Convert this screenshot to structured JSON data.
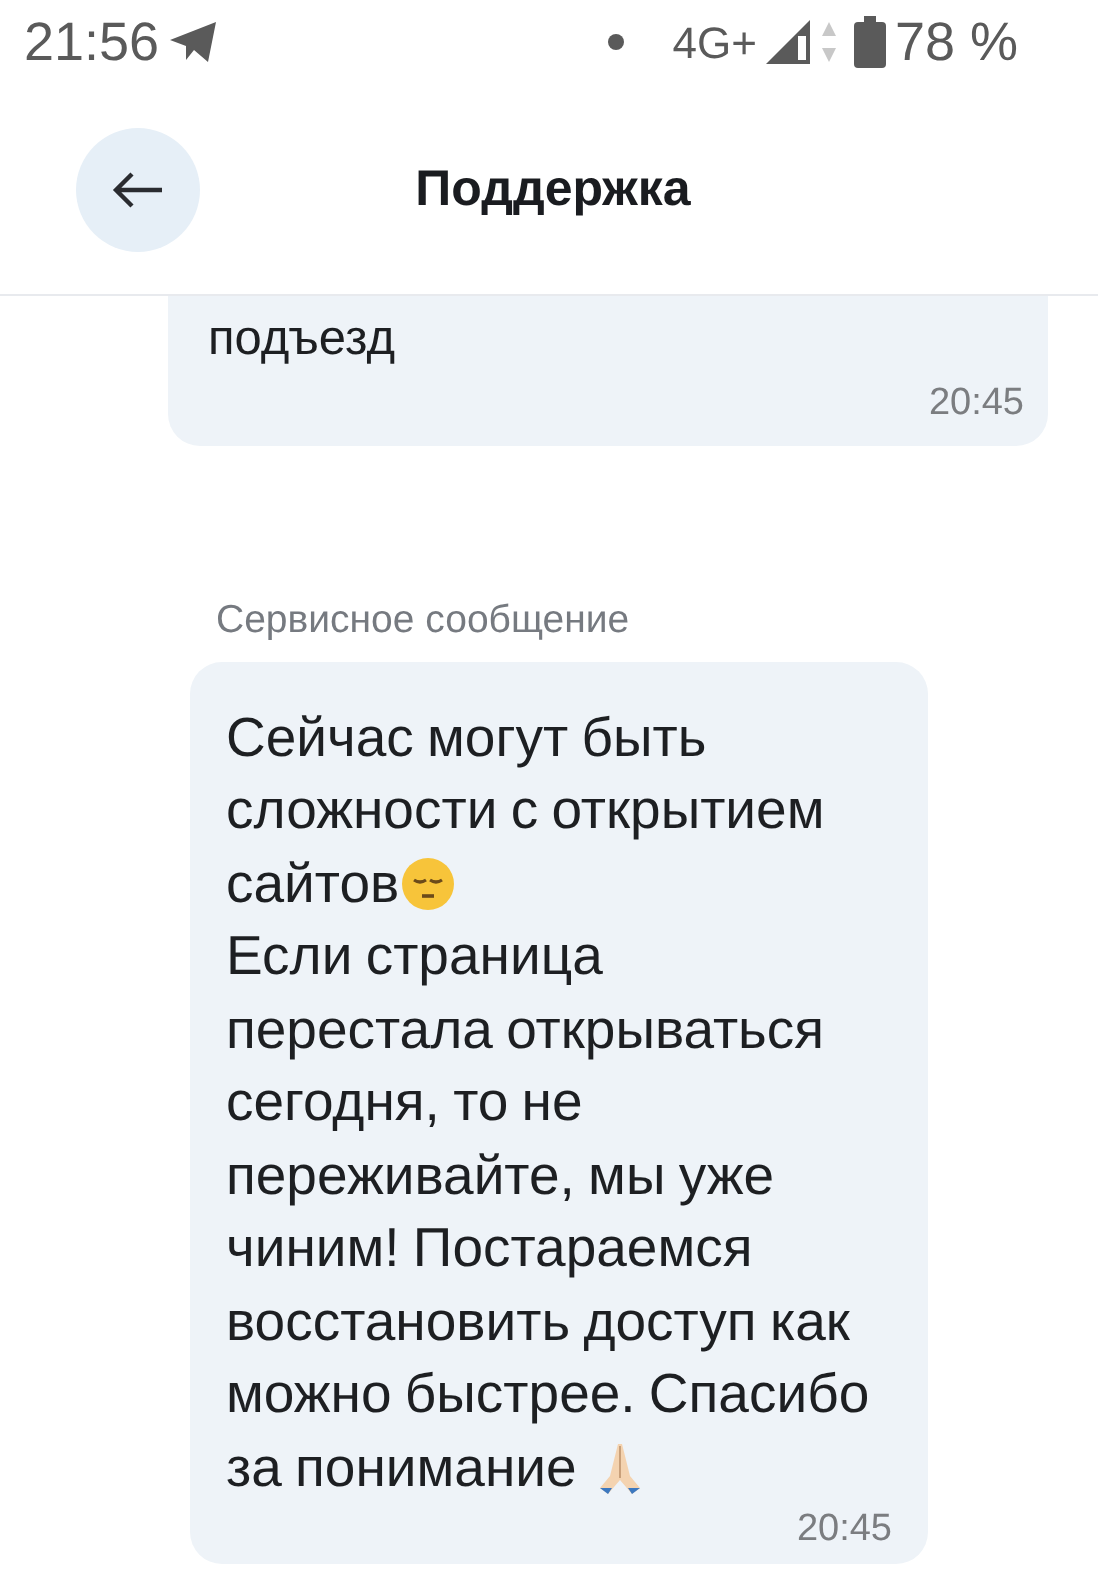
{
  "status_bar": {
    "time": "21:56",
    "network": "4G+",
    "battery": "78 %"
  },
  "header": {
    "title": "Поддержка"
  },
  "messages": [
    {
      "kind": "user",
      "segments": [
        {
          "kind": "text",
          "text": "подъезд"
        }
      ],
      "time": "20:45"
    },
    {
      "kind": "service",
      "label": "Сервисное сообщение",
      "segments": [
        {
          "kind": "text",
          "text": "Сейчас могут быть сложности с открытием"
        },
        {
          "kind": "sad-line",
          "text": "сайтов"
        },
        {
          "kind": "text",
          "text": "Если страница перестала открываться сегодня, то не переживайте, мы уже чиним! Постараемся восстановить доступ как можно быстрее. Спасибо"
        },
        {
          "kind": "pray-line",
          "text": "за понимание"
        }
      ],
      "time": "20:45"
    }
  ]
}
